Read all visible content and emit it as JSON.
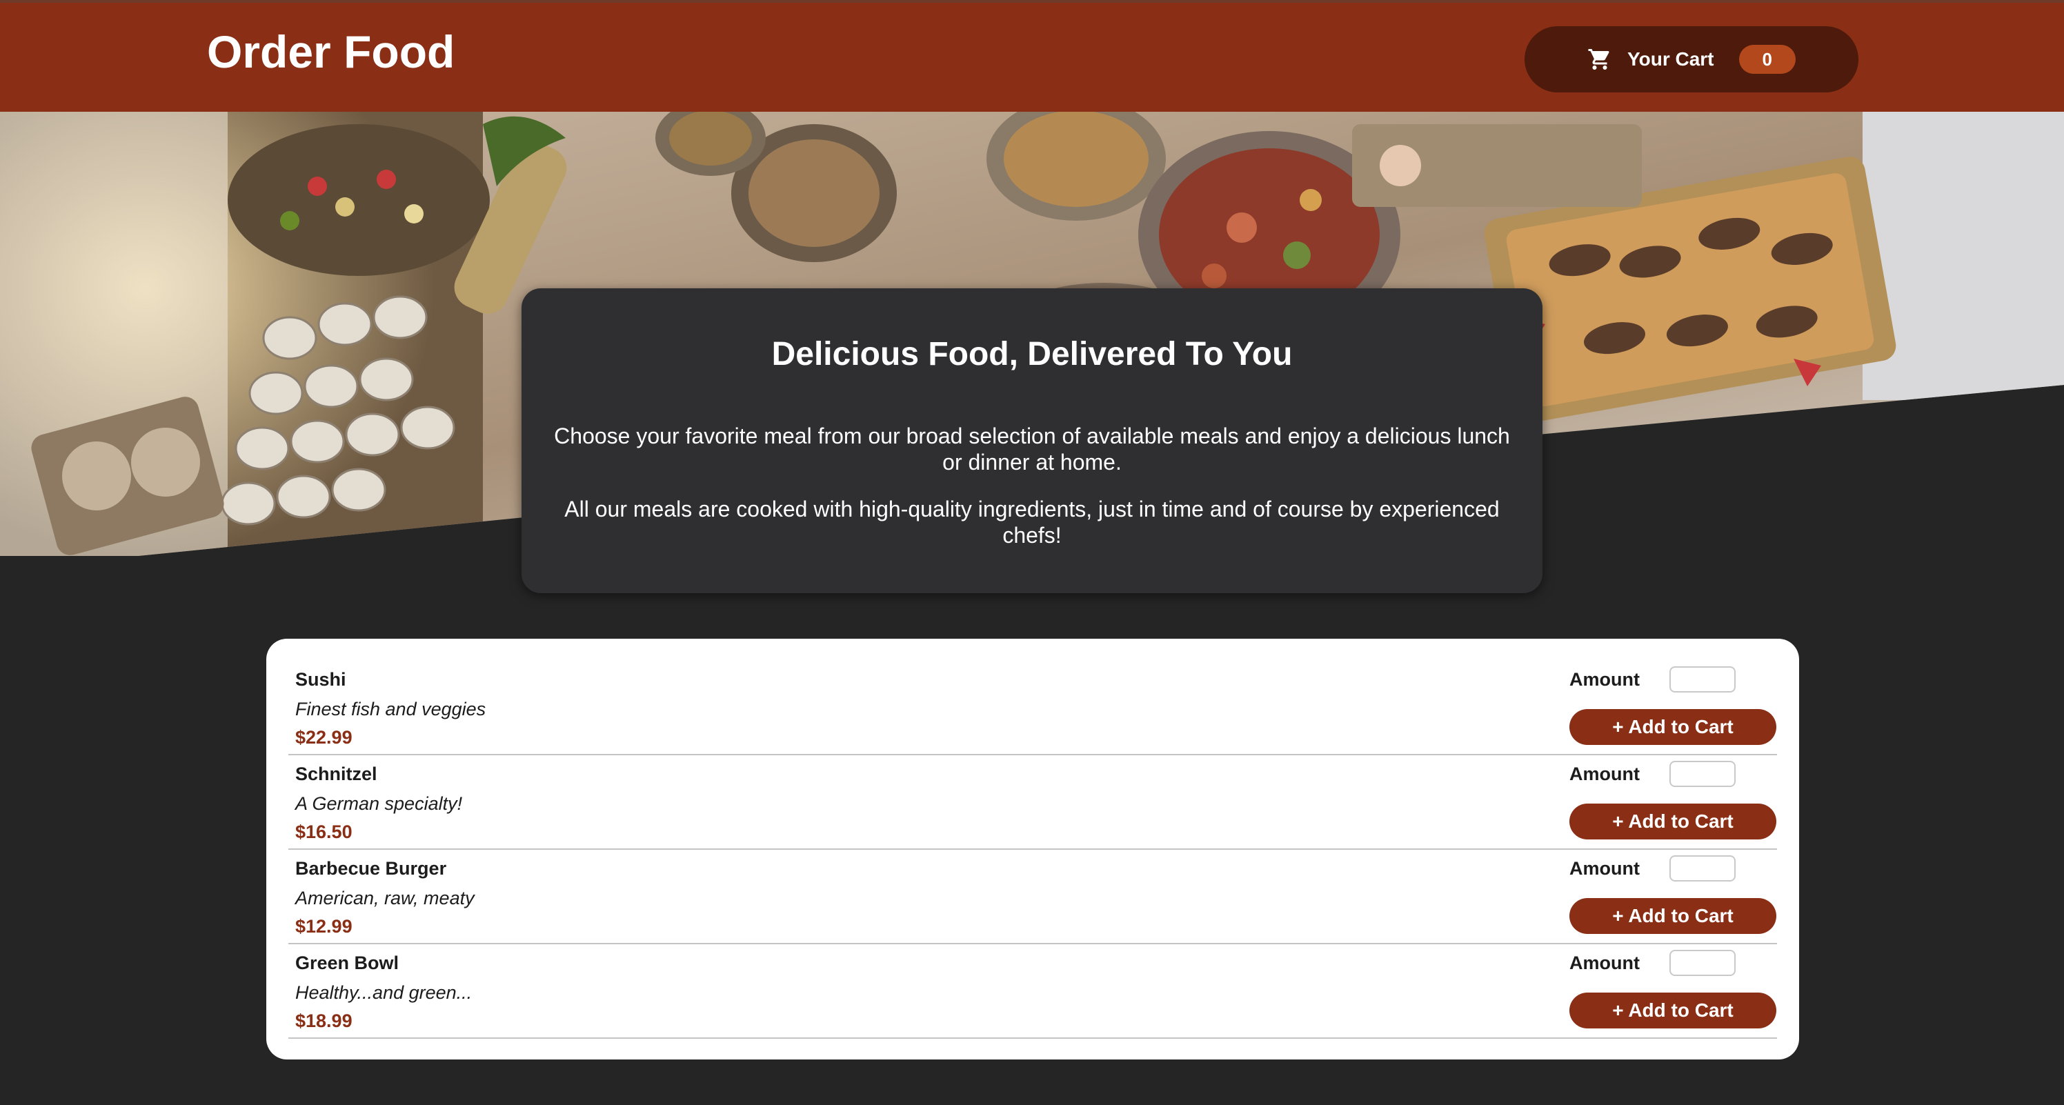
{
  "header": {
    "title": "Order Food",
    "cart": {
      "label": "Your Cart",
      "count": "0",
      "icon": "cart-icon"
    }
  },
  "hero": {
    "image_subject": "buffet table with platters of food"
  },
  "summary": {
    "heading": "Delicious Food, Delivered To You",
    "paragraph_1": "Choose your favorite meal from our broad selection of available meals and enjoy a delicious lunch or dinner at home.",
    "paragraph_2": "All our meals are cooked with high-quality ingredients, just in time and of course by experienced chefs!"
  },
  "meals": {
    "amount_label": "Amount",
    "add_label": "+ Add to Cart",
    "items": [
      {
        "name": "Sushi",
        "description": "Finest fish and veggies",
        "price": "$22.99",
        "amount": ""
      },
      {
        "name": "Schnitzel",
        "description": "A German specialty!",
        "price": "$16.50",
        "amount": ""
      },
      {
        "name": "Barbecue Burger",
        "description": "American, raw, meaty",
        "price": "$12.99",
        "amount": ""
      },
      {
        "name": "Green Bowl",
        "description": "Healthy...and green...",
        "price": "$18.99",
        "amount": ""
      }
    ]
  },
  "colors": {
    "header_bg": "#8a2f15",
    "cart_button_bg": "#4d1a0b",
    "badge_bg": "#b3481d",
    "page_bg": "#252525",
    "summary_bg": "#2f2e31",
    "price": "#8a2f15",
    "button_bg": "#8a2f15"
  }
}
